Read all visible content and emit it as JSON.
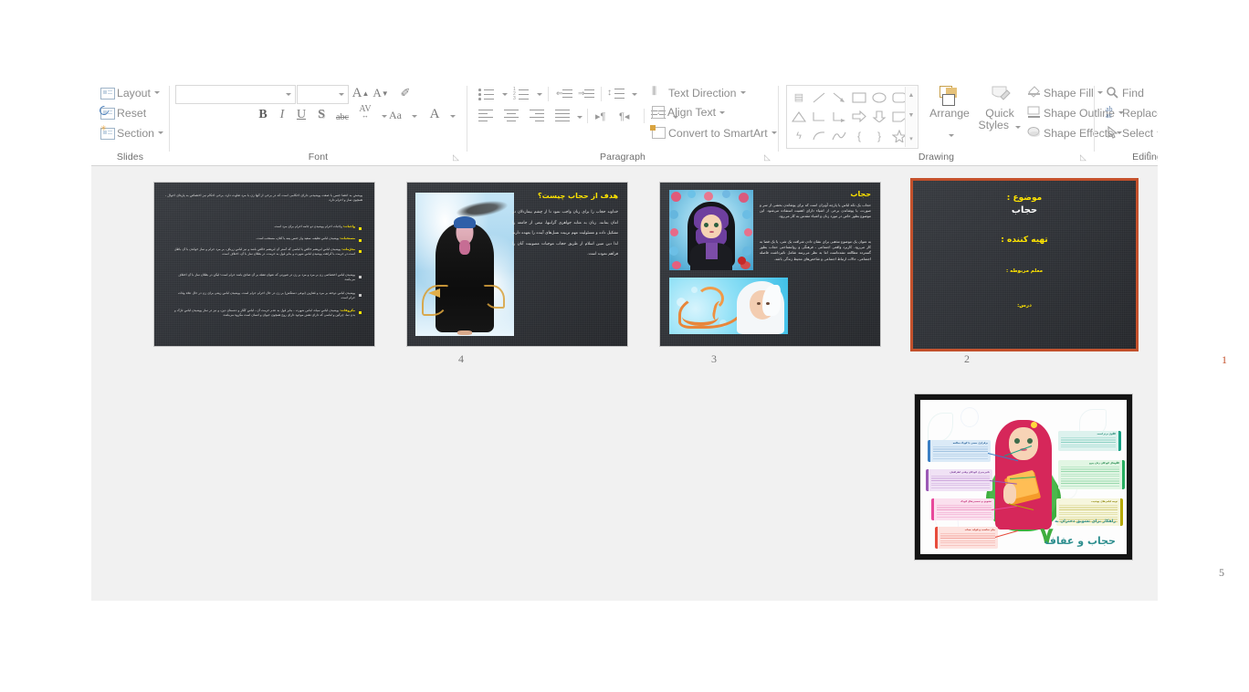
{
  "app": {
    "name": "Microsoft PowerPoint",
    "view": "slide-sorter"
  },
  "ribbon": {
    "groups": [
      {
        "id": "slides",
        "label": "Slides"
      },
      {
        "id": "font",
        "label": "Font"
      },
      {
        "id": "paragraph",
        "label": "Paragraph"
      },
      {
        "id": "drawing",
        "label": "Drawing"
      },
      {
        "id": "editing",
        "label": "Editing"
      }
    ],
    "slides_group": {
      "layout": "Layout",
      "reset": "Reset",
      "section": "Section"
    },
    "font_group": {
      "font_name_value": "",
      "font_size_value": "",
      "grow_font": "A",
      "shrink_font": "A",
      "clear_formatting": "clear-formatting-icon",
      "bold": "B",
      "italic": "I",
      "underline": "U",
      "shadow": "S",
      "strikethrough": "abc",
      "character_spacing": "AV",
      "change_case": "Aa",
      "font_color": "A"
    },
    "paragraph_group": {
      "text_direction": "Text Direction",
      "align_text": "Align Text",
      "convert_to_smartart": "Convert to SmartArt"
    },
    "drawing_group": {
      "arrange": "Arrange",
      "quick_styles_line1": "Quick",
      "quick_styles_line2": "Styles",
      "shape_fill": "Shape Fill",
      "shape_outline": "Shape Outline",
      "shape_effects": "Shape Effects"
    },
    "editing_group": {
      "find": "Find",
      "replace": "Replace",
      "select": "Select"
    },
    "collapse_ribbon": "collapse-ribbon-icon"
  },
  "colors": {
    "selection_border": "#c4512c",
    "sorter_background": "#f1f1f1",
    "slide_background": "#2f3237",
    "accent_yellow": "#ffe400",
    "ribbon_text": "#8d8d8d"
  },
  "slides": [
    {
      "number": "1",
      "selected": true,
      "kind": "title",
      "lines": [
        {
          "text": "موضوع :",
          "color": "#ffe400",
          "size": 8.5
        },
        {
          "text": "حجاب",
          "color": "#ffffff",
          "size": 9.5
        },
        {
          "text": "تهیه کننده :",
          "color": "#ffe400",
          "size": 8.5
        },
        {
          "text": "معلم مربوطه :",
          "color": "#ffe400",
          "size": 5.5
        },
        {
          "text": "درس:",
          "color": "#ffe400",
          "size": 5.5
        }
      ]
    },
    {
      "number": "2",
      "selected": false,
      "kind": "content",
      "title": "حجاب",
      "paragraphs": [
        "حجاب یک تکه لباس یا پارچه آویزان است که برای پوشاندن بخشی از سر و صورت، یا پوشاندن برخی از اشیاء دارای اهمیت استفاده می‌شود. این موضوع بطور خاص در مورد زنان و اشیاء مقدس به کار می‌رود.",
        "به عنوان یک موضوع مذهبی برای نشان دادن شرافت یک شی، یا یک فضا به کار می‌رود. کاربرد واقعی اجتماعی ـ فرهنگی و روانشناختی حجاب بطور گسترده مطالعه نشده‌است اما به نظر می‌رسد شامل تاثیرداشت فاصله اجتماعی، حالات ارتباط اجتماعی و شاخص‌های محیط زندگی باشد."
      ],
      "images": [
        "hijab-portrait-illustration",
        "hijab-calligraphy-banner"
      ]
    },
    {
      "number": "3",
      "selected": false,
      "kind": "content",
      "title": "هدف از حجاب چیست؟",
      "paragraphs": [
        "خداوند حجاب را برای زنان واجب نمود تا از چشم بیماردلان در امان بمانند. زنان به مثابه جواهری گرانبها، نیمی از جامعه را تشکیل داده و مسئولیت مهم تربیت نسل‌های آینده را بعهده دارند لذا دین مبین اسلام از طریق حجاب موجبات مصونیت آنان را فراهم نموده است."
      ],
      "images": [
        "chador-woman-photo"
      ]
    },
    {
      "number": "4",
      "selected": false,
      "kind": "bullets",
      "intro": "پوشش به اعضا جنس یا صفت پوشیدنی دارای احکامی است که در برخی از آنها زن با مرد تفاوت دارد. برخی احکام نیز اختصاص به پاره‌ای احوال ، همچون نماز و احرام دارد.",
      "bullets": [
        {
          "head": "واجبات:",
          "text": "واجبات احرام پوشیدن دو جامه احرام برای مرد است."
        },
        {
          "head": "مستحبات:",
          "text": "پوشیدن لباس نظیف، سفید واز جنس پنبه یا کتان، مستحب است."
        },
        {
          "head": "محرّمات:",
          "text": "پوشیدن لباس ابریشم خالص یا لباسی که آستر آن ابریشم خالص باشد و نیز لباس زرباف، بر مرد حرام و نماز خواندن با آن باطل است.در حرمت با کراهت پوشیدن لباس شهرت و بنابر قول به حرمت، در بطلان نماز با آن، اختلاف است."
        },
        {
          "head": "",
          "text": "پوشیدن لباس اختصاصی زن بر مرد و مرد بر زن در صورتی که عنوان تشبّه بر آن صادق باشد حرام است؛ لیکن در بطلان نماز با آن اختلاف می‌باشد."
        },
        {
          "head": "",
          "text": "پوشیدن لباس دوخته بر مرد و قفازین (نوعی دستکش) بر زن در حال احرام حرام است. پوشیدن لباس زینتی برای زن در حال عدّه وفات حرام است."
        },
        {
          "head": "مکروهات:",
          "text": "پوشیدن لباس سیاه، لباس شهرت ـ بنابر قول به عدم حرمت آن ـ لباس کفّار و دشمنان دین، و نیز در نماز پوشیدن لباس نازک و بدن نما، چرکین و لباسی که دارای نقش موجود دارای روح همچون حیوان و انسان است مکروه می‌باشد."
        }
      ]
    },
    {
      "number": "5",
      "selected": false,
      "kind": "image",
      "title_big": "حجاب و عفاف",
      "title_small": "راهکار برای تشویق دختران به",
      "numeral": "٧",
      "callouts": [
        {
          "label": "برقراری حسی با کودک سالخه",
          "color": "#3b7fc4"
        },
        {
          "label": "تاثیرپذیری کودکان وقتی اطرافیان",
          "color": "#9b59b6"
        },
        {
          "label": "تشویق و تحسین‌های کودک",
          "color": "#e8489b"
        },
        {
          "label": "بیان مناسب و فواید حجاب",
          "color": "#e74c3c"
        },
        {
          "label": "الگوی برتر است",
          "color": "#16a085"
        },
        {
          "label": "الگوهای کودکان زنان پیرو",
          "color": "#27ae60"
        },
        {
          "label": "توجه لباس‌های پوشیده",
          "color": "#b5a800"
        }
      ]
    }
  ]
}
